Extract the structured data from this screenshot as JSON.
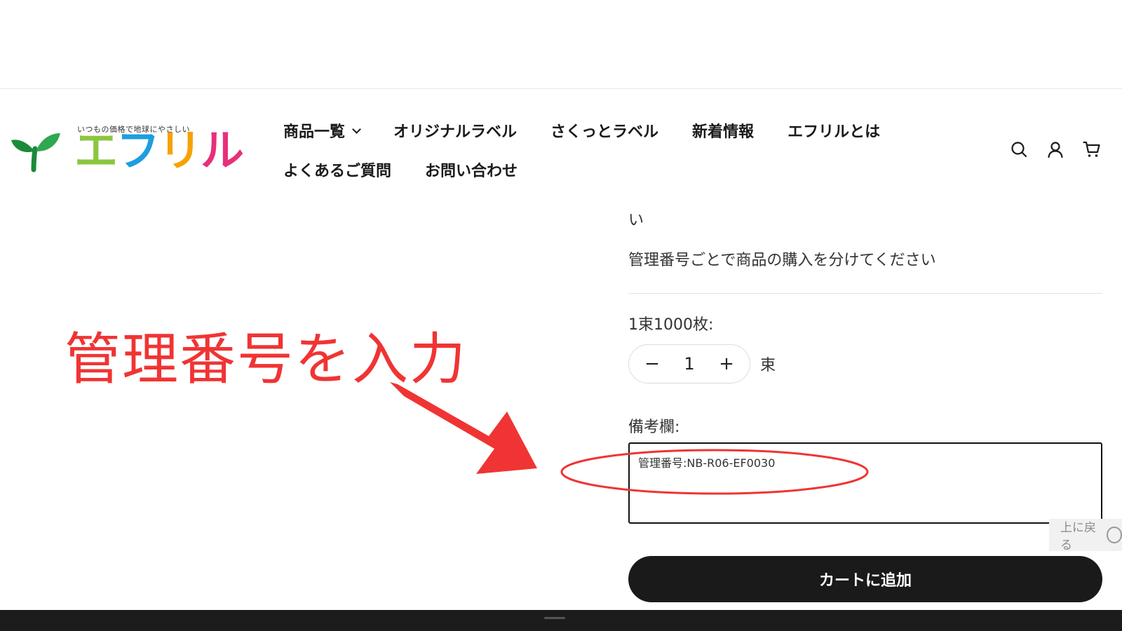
{
  "logo": {
    "tagline": "いつもの価格で地球にやさしい",
    "brand_chars": [
      "エ",
      "フ",
      "リ",
      "ル"
    ]
  },
  "nav": {
    "row1": [
      "商品一覧",
      "オリジナルラベル",
      "さくっとラベル",
      "新着情報",
      "エフリルとは"
    ],
    "row2": [
      "よくあるご質問",
      "お問い合わせ"
    ]
  },
  "header_icons": [
    "search-icon",
    "account-icon",
    "cart-icon"
  ],
  "product": {
    "text_fragment": "い",
    "notice": "管理番号ごとで商品の購入を分けてください",
    "quantity_label": "1束1000枚:",
    "quantity": {
      "minus": "−",
      "value": "1",
      "plus": "+",
      "unit": "束"
    },
    "memo_label": "備考欄:",
    "memo_value": "管理番号:NB-R06-EF0030",
    "add_to_cart": "カートに追加"
  },
  "back_to_top": "上に戻る",
  "annotation": {
    "text": "管理番号を入力",
    "color": "#f03434"
  }
}
